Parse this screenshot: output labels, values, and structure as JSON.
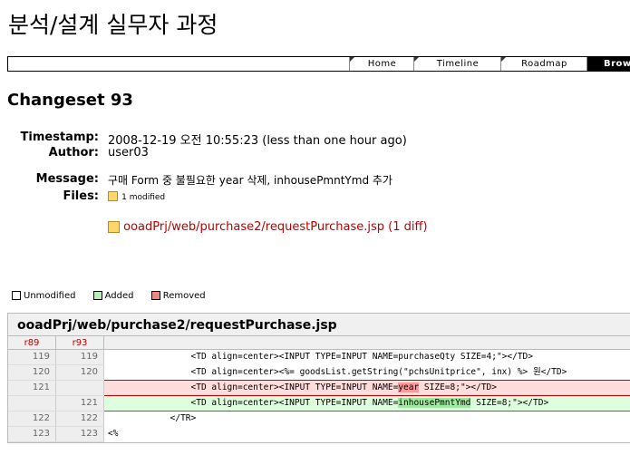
{
  "site": {
    "title": "분석/설계 실무자 과정"
  },
  "nav": {
    "items": [
      "Home",
      "Timeline",
      "Roadmap",
      "Brow"
    ]
  },
  "changeset": {
    "title": "Changeset 93",
    "timestamp_label": "Timestamp:",
    "timestamp": "2008-12-19 오전 10:55:23 (less than one hour ago)",
    "author_label": "Author:",
    "author": "user03",
    "message_label": "Message:",
    "message": "구매 Form 중 불필요한 year 삭제, inhousePmntYmd 추가",
    "files_label": "Files:",
    "files_summary": "1 modified",
    "file_path": "ooadPrj/web/purchase2/requestPurchase.jsp",
    "file_diff_open": "(",
    "file_diff_link": "1 diff",
    "file_diff_close": ")"
  },
  "legend": {
    "unmodified": "Unmodified",
    "added": "Added",
    "removed": "Removed",
    "colors": {
      "unmodified": "#ffffff",
      "added": "#bbeebb",
      "removed": "#ee8888"
    }
  },
  "diff": {
    "file": "ooadPrj/web/purchase2/requestPurchase.jsp",
    "old_rev": "r89",
    "new_rev": "r93",
    "lines": [
      {
        "old": "119",
        "new": "119",
        "type": "ctx",
        "code": "                <TD align=center><INPUT TYPE=INPUT NAME=purchaseQty SIZE=4;\"></TD>"
      },
      {
        "old": "120",
        "new": "120",
        "type": "ctx",
        "code": "                <TD align=center><%= goodsList.getString(\"pchsUnitprice\", inx) %> 원</TD>"
      },
      {
        "old": "121",
        "new": "",
        "type": "rem",
        "pre": "                <TD align=center><INPUT TYPE=INPUT NAME=",
        "hl": "year",
        "post": " SIZE=8;\"></TD>"
      },
      {
        "old": "",
        "new": "121",
        "type": "add",
        "pre": "                <TD align=center><INPUT TYPE=INPUT NAME=",
        "hl": "inhousePmntYmd",
        "post": " SIZE=8;\"></TD>"
      },
      {
        "old": "122",
        "new": "122",
        "type": "ctx",
        "code": "            </TR>"
      },
      {
        "old": "123",
        "new": "123",
        "type": "ctx",
        "code": "<%"
      }
    ]
  }
}
